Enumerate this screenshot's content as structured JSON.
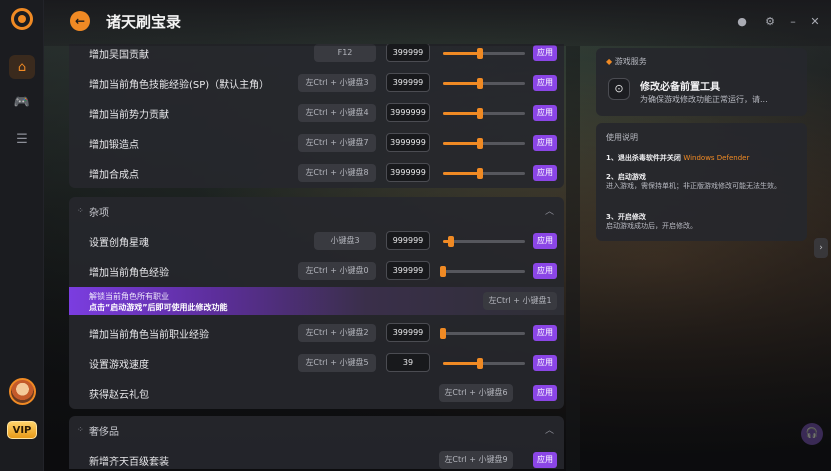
{
  "app": {
    "title": "诸天刷宝录"
  },
  "header": {
    "back_icon": "arrow-left",
    "ctrl_icons": [
      "record",
      "settings",
      "minimize",
      "close"
    ]
  },
  "sidebar": {
    "items": [
      "home",
      "gamepad",
      "database"
    ],
    "vip_label": "VIP"
  },
  "group1": {
    "rows": [
      {
        "label": "增加吴国贡献",
        "hotkey": "F12",
        "value": "399999",
        "level": 0.45,
        "apply": "应用"
      },
      {
        "label": "增加当前角色技能经验(SP)（默认主角）",
        "hotkey": "左Ctrl + 小键盘3",
        "value": "399999",
        "level": 0.45,
        "apply": "应用"
      },
      {
        "label": "增加当前势力贡献",
        "hotkey": "左Ctrl + 小键盘4",
        "value": "3999999",
        "level": 0.45,
        "apply": "应用"
      },
      {
        "label": "增加锻造点",
        "hotkey": "左Ctrl + 小键盘7",
        "value": "3999999",
        "level": 0.45,
        "apply": "应用"
      },
      {
        "label": "增加合成点",
        "hotkey": "左Ctrl + 小键盘8",
        "value": "3999999",
        "level": 0.45,
        "apply": "应用"
      }
    ]
  },
  "section_misc": {
    "title": "杂项",
    "rows": [
      {
        "label": "设置创角星魂",
        "hotkey": "小键盘3",
        "value": "999999",
        "level": 0.1,
        "apply": "应用"
      },
      {
        "label": "增加当前角色经验",
        "hotkey": "左Ctrl + 小键盘0",
        "value": "399999",
        "level": 0.0,
        "apply": "应用"
      }
    ],
    "banner": {
      "line1": "解锁当前角色所有职业",
      "line2": "点击“启动游戏”后即可使用此修改功能",
      "hotkey": "左Ctrl + 小键盘1"
    },
    "rows2": [
      {
        "label": "增加当前角色当前职业经验",
        "hotkey": "左Ctrl + 小键盘2",
        "value": "399999",
        "level": 0.0,
        "apply": "应用"
      },
      {
        "label": "设置游戏速度",
        "hotkey": "左Ctrl + 小键盘5",
        "value": "39",
        "level": 0.45,
        "apply": "应用"
      },
      {
        "label": "获得赵云礼包",
        "hotkey": "左Ctrl + 小键盘6",
        "apply": "应用"
      }
    ]
  },
  "section_luxury": {
    "title": "奢侈品",
    "rows": [
      {
        "label": "新增齐天百级套装",
        "hotkey": "左Ctrl + 小键盘9",
        "apply": "应用"
      }
    ]
  },
  "right": {
    "service_title": "游戏服务",
    "tool_title": "修改必备前置工具",
    "tool_desc": "为确保游戏修改功能正常运行，请...",
    "instructions_title": "使用说明",
    "step1_title": "1、退出杀毒软件并关闭",
    "step1_highlight": "Windows Defender",
    "step2_title": "2、启动游戏",
    "step2_text": "进入游戏，需保持单机；非正版游戏修改可能无法生效。",
    "step3_title": "3、开启修改",
    "step3_text": "启动游戏成功后，开启修改。"
  },
  "colors": {
    "accent": "#f08a24",
    "apply": "#8b46e6",
    "banner": "#7b3de0"
  }
}
